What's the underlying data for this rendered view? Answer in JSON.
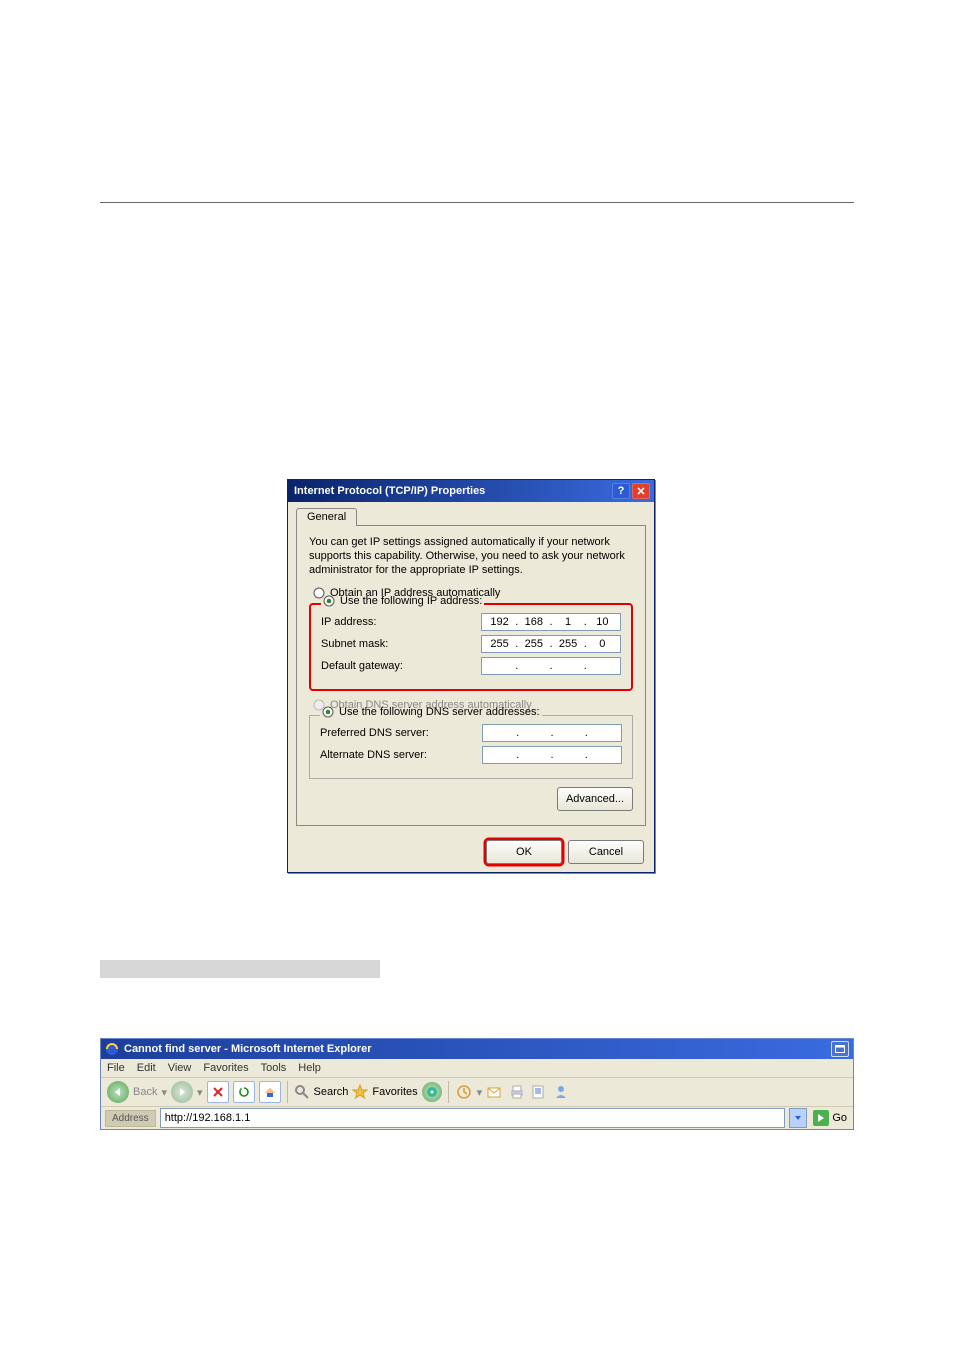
{
  "dialog": {
    "title": "Internet Protocol (TCP/IP) Properties",
    "tab": "General",
    "description": "You can get IP settings assigned automatically if your network supports this capability. Otherwise, you need to ask your network administrator for the appropriate IP settings.",
    "obtain_ip_auto": "Obtain an IP address automatically",
    "use_following_ip": "Use the following IP address:",
    "ip_label": "IP address:",
    "ip_value": [
      "192",
      "168",
      "1",
      "10"
    ],
    "subnet_label": "Subnet mask:",
    "subnet_value": [
      "255",
      "255",
      "255",
      "0"
    ],
    "gateway_label": "Default gateway:",
    "gateway_value": [
      "",
      "",
      "",
      ""
    ],
    "obtain_dns_auto": "Obtain DNS server address automatically",
    "use_following_dns": "Use the following DNS server addresses:",
    "preferred_label": "Preferred DNS server:",
    "preferred_value": [
      "",
      "",
      "",
      ""
    ],
    "alternate_label": "Alternate DNS server:",
    "alternate_value": [
      "",
      "",
      "",
      ""
    ],
    "advanced": "Advanced...",
    "ok": "OK",
    "cancel": "Cancel"
  },
  "browser": {
    "title": "Cannot find server - Microsoft Internet Explorer",
    "menu": [
      "File",
      "Edit",
      "View",
      "Favorites",
      "Tools",
      "Help"
    ],
    "back": "Back",
    "search": "Search",
    "favorites": "Favorites",
    "address_label": "Address",
    "address_value": "http://192.168.1.1",
    "go": "Go"
  }
}
